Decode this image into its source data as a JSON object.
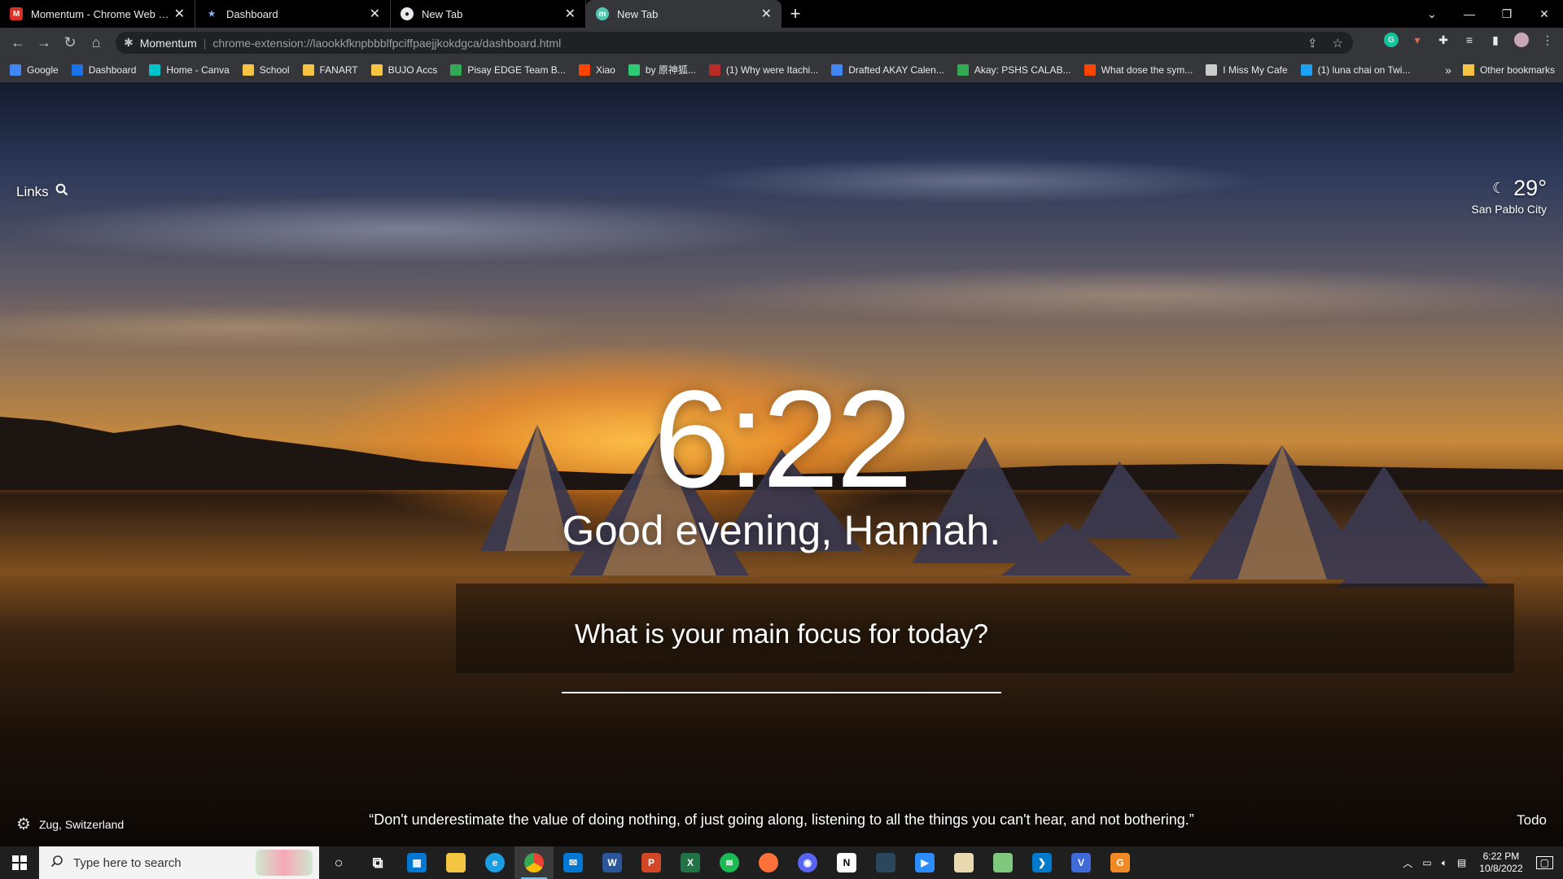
{
  "browser": {
    "tabs": [
      {
        "title": "Momentum - Chrome Web Store",
        "color": "#d93025",
        "glyph": "M",
        "active": false
      },
      {
        "title": "Dashboard",
        "color": "#1a73e8",
        "glyph": "★",
        "active": false
      },
      {
        "title": "New Tab",
        "color": "#ffffff",
        "glyph": "",
        "active": false
      },
      {
        "title": "New Tab",
        "color": "#4ec9b0",
        "glyph": "m",
        "active": true
      }
    ],
    "address": {
      "extension_name": "Momentum",
      "url": "chrome-extension://laookkfknpbbblfpciffpaejjkokdgca/dashboard.html"
    },
    "bookmarks": [
      {
        "label": "Google",
        "color": "#4285f4"
      },
      {
        "label": "Dashboard",
        "color": "#1a73e8"
      },
      {
        "label": "Home - Canva",
        "color": "#00c4cc"
      },
      {
        "label": "School",
        "color": "#f6c343"
      },
      {
        "label": "FANART",
        "color": "#f6c343"
      },
      {
        "label": "BUJO Accs",
        "color": "#f6c343"
      },
      {
        "label": "Pisay EDGE Team B...",
        "color": "#34a853"
      },
      {
        "label": "Xiao",
        "color": "#ff4500"
      },
      {
        "label": "by 原神狐...",
        "color": "#2ecc71"
      },
      {
        "label": "(1) Why were Itachi...",
        "color": "#b92b27"
      },
      {
        "label": "Drafted AKAY Calen...",
        "color": "#4285f4"
      },
      {
        "label": "Akay: PSHS CALAB...",
        "color": "#34a853"
      },
      {
        "label": "What dose the sym...",
        "color": "#ff4500"
      },
      {
        "label": "I Miss My Cafe",
        "color": "#cccccc"
      },
      {
        "label": "(1) luna chai on Twi...",
        "color": "#1da1f2"
      }
    ],
    "bookmarks_overflow": "»",
    "other_bookmarks": "Other bookmarks"
  },
  "momentum": {
    "links_label": "Links",
    "weather": {
      "temp": "29°",
      "city": "San Pablo City"
    },
    "time": "6:22",
    "greeting": "Good evening, Hannah.",
    "focus_prompt": "What is your main focus for today?",
    "focus_value": "",
    "photo_location": "Zug, Switzerland",
    "quote": "“Don't underestimate the value of doing nothing, of just going along, listening to all the things you can't hear, and not bothering.”",
    "todo_label": "Todo"
  },
  "taskbar": {
    "search_placeholder": "Type here to search",
    "apps": [
      {
        "name": "cortana",
        "color": "transparent",
        "glyph": "○"
      },
      {
        "name": "task-view",
        "color": "transparent",
        "glyph": "⧉"
      },
      {
        "name": "microsoft-store",
        "color": "#0078d4",
        "glyph": "▦"
      },
      {
        "name": "file-explorer",
        "color": "#f4c542",
        "glyph": ""
      },
      {
        "name": "edge",
        "color": "#1b9de2",
        "glyph": "e"
      },
      {
        "name": "chrome",
        "color": "#34a853",
        "glyph": "●"
      },
      {
        "name": "mail",
        "color": "#0078d4",
        "glyph": "✉"
      },
      {
        "name": "word",
        "color": "#2b579a",
        "glyph": "W"
      },
      {
        "name": "powerpoint",
        "color": "#d24726",
        "glyph": "P"
      },
      {
        "name": "excel",
        "color": "#217346",
        "glyph": "X"
      },
      {
        "name": "spotify",
        "color": "#1db954",
        "glyph": "≋"
      },
      {
        "name": "firefox",
        "color": "#ff7139",
        "glyph": ""
      },
      {
        "name": "discord",
        "color": "#5865f2",
        "glyph": "◉"
      },
      {
        "name": "notion",
        "color": "#ffffff",
        "glyph": "N"
      },
      {
        "name": "steam",
        "color": "#2a475e",
        "glyph": ""
      },
      {
        "name": "zoom",
        "color": "#2d8cff",
        "glyph": "▶"
      },
      {
        "name": "paint",
        "color": "#e8d9b0",
        "glyph": ""
      },
      {
        "name": "notepad",
        "color": "#7fc97f",
        "glyph": ""
      },
      {
        "name": "vscode",
        "color": "#007acc",
        "glyph": "❯"
      },
      {
        "name": "vpn",
        "color": "#3f6ad8",
        "glyph": "V"
      },
      {
        "name": "grammarly-app",
        "color": "#f08a24",
        "glyph": "G"
      }
    ],
    "tray": {
      "time": "6:22 PM",
      "date": "10/8/2022",
      "notifications": "1"
    }
  }
}
